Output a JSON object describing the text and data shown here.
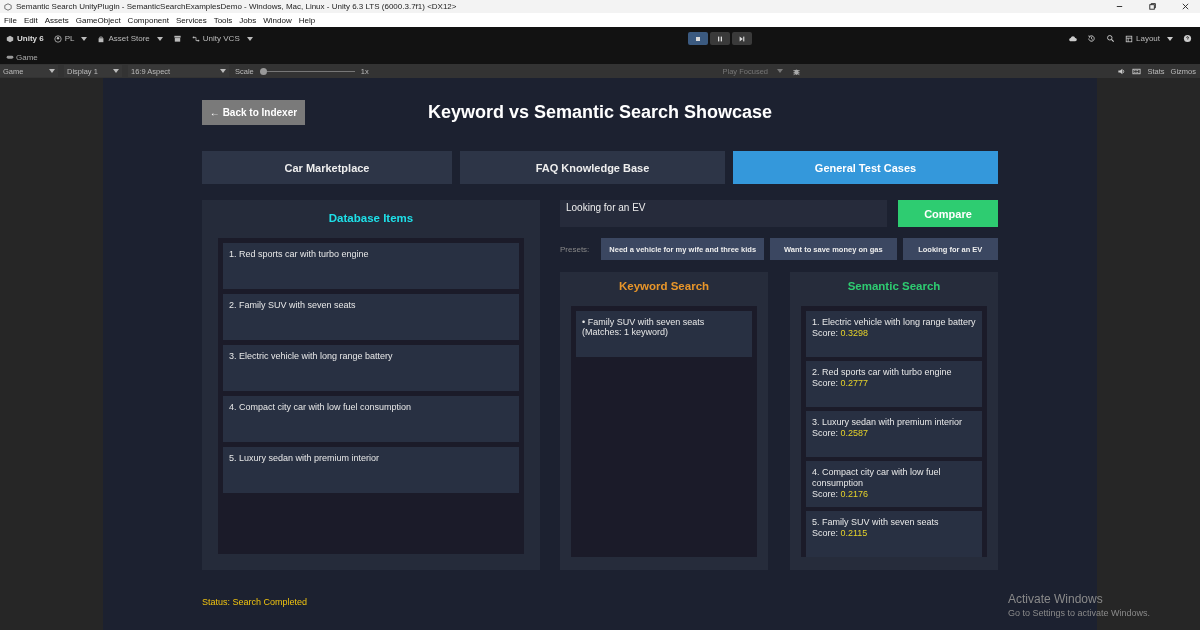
{
  "window": {
    "title": "Semantic Search UnityPlugin - SemanticSearchExamplesDemo - Windows, Mac, Linux - Unity 6.3 LTS (6000.3.7f1) <DX12>"
  },
  "menu": [
    "File",
    "Edit",
    "Assets",
    "GameObject",
    "Component",
    "Services",
    "Tools",
    "Jobs",
    "Window",
    "Help"
  ],
  "toolbar": {
    "product": "Unity 6",
    "account": "PL",
    "asset_store": "Asset Store",
    "vcs": "Unity VCS",
    "layout": "Layout",
    "transport": [
      {
        "kind": "stop",
        "selected": true
      },
      {
        "kind": "pause",
        "selected": false
      },
      {
        "kind": "step",
        "selected": false
      }
    ]
  },
  "view_tab": "Game",
  "game_bar": {
    "mode": "Game",
    "display": "Display 1",
    "aspect": "16:9 Aspect",
    "scale_label": "Scale",
    "scale": "1x",
    "scale_slider": {
      "level": 0
    },
    "play_mode": "Play Focused",
    "stats": "Stats",
    "gizmos": "Gizmos"
  },
  "game": {
    "back_button": "← Back to Indexer",
    "title": "Keyword vs Semantic Search Showcase",
    "tabs": [
      {
        "label": "Car Marketplace",
        "selected": false
      },
      {
        "label": "FAQ Knowledge Base",
        "selected": false
      },
      {
        "label": "General Test Cases",
        "selected": true
      }
    ],
    "database": {
      "title": "Database Items",
      "items": [
        "1. Red sports car with turbo engine",
        "2. Family SUV with seven seats",
        "3. Electric vehicle with long range battery",
        "4. Compact city car with low fuel consumption",
        "5. Luxury sedan with premium interior"
      ]
    },
    "query": {
      "value": "Looking for an EV"
    },
    "compare_button": "Compare",
    "presets": {
      "label": "Presets:",
      "items": [
        "Need a vehicle for my wife and three kids",
        "Want to save money on gas",
        "Looking for an EV"
      ]
    },
    "keyword": {
      "title": "Keyword Search",
      "results": [
        {
          "text": "• Family SUV with seven seats",
          "detail": "(Matches: 1 keyword)"
        }
      ]
    },
    "semantic": {
      "title": "Semantic Search",
      "results": [
        {
          "text": "1. Electric vehicle with long range battery",
          "label": "Score:",
          "score": "0.3298"
        },
        {
          "text": "2. Red sports car with turbo engine",
          "label": "Score:",
          "score": "0.2777"
        },
        {
          "text": "3. Luxury sedan with premium interior",
          "label": "Score:",
          "score": "0.2587"
        },
        {
          "text": "4. Compact city car with low fuel consumption",
          "label": "Score:",
          "score": "0.2176"
        },
        {
          "text": "5. Family SUV with seven seats",
          "label": "Score:",
          "score": "0.2115"
        }
      ]
    },
    "status": "Status: Search Completed"
  },
  "os_notice": {
    "title": "Activate Windows",
    "text": "Go to Settings to activate Windows."
  }
}
